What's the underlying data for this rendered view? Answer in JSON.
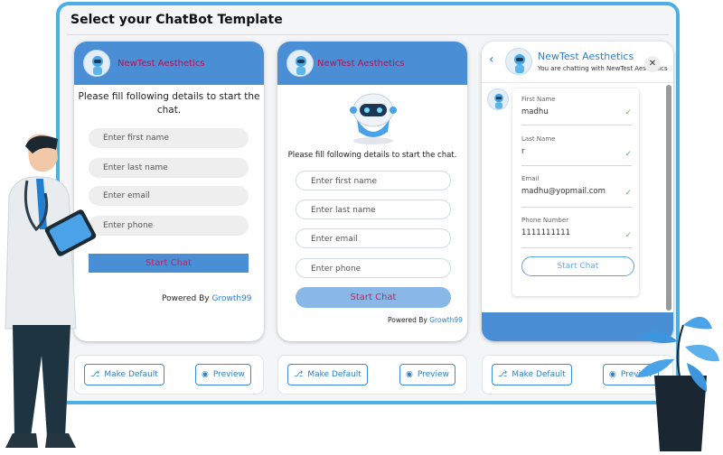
{
  "page": {
    "title": "Select your ChatBot Template"
  },
  "colors": {
    "frame_border": "#4ab0e3",
    "header_blue": "#4a8ed5",
    "bot_name": "#b01458",
    "link_blue": "#2e7fd0",
    "check_green": "#58b56e"
  },
  "templates": [
    {
      "bot_name": "NewTest Aesthetics",
      "intro": "Please fill following details to start the chat.",
      "fields": [
        "Enter first name",
        "Enter last name",
        "Enter email",
        "Enter phone"
      ],
      "start_button": "Start Chat",
      "powered_prefix": "Powered By ",
      "powered_brand": "Growth99"
    },
    {
      "bot_name": "NewTest Aesthetics",
      "intro": "Please fill following details to start the chat.",
      "fields": [
        "Enter first name",
        "Enter last name",
        "Enter email",
        "Enter phone"
      ],
      "start_button": "Start Chat",
      "powered_prefix": "Powered By ",
      "powered_brand": "Growth99"
    },
    {
      "bot_name": "NewTest Aesthetics",
      "subtitle": "You are chatting with NewTest Aesthetics",
      "fields": [
        {
          "label": "First Name",
          "value": "madhu"
        },
        {
          "label": "Last Name",
          "value": "r"
        },
        {
          "label": "Email",
          "value": "madhu@yopmail.com"
        },
        {
          "label": "Phone Number",
          "value": "1111111111"
        }
      ],
      "start_button": "Start Chat"
    }
  ],
  "actions": {
    "make_default": "Make Default",
    "preview": "Preview"
  },
  "icons": [
    "bot-avatar-icon",
    "bookmark-icon",
    "eye-icon",
    "chevron-left-icon",
    "close-icon",
    "check-icon"
  ]
}
